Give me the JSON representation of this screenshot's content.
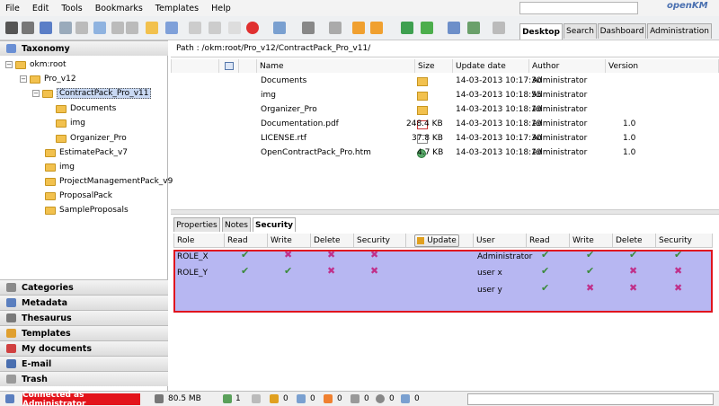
{
  "menu": [
    "File",
    "Edit",
    "Tools",
    "Bookmarks",
    "Templates",
    "Help"
  ],
  "logo": "openKM",
  "top_tabs": [
    "Desktop",
    "Search",
    "Dashboard",
    "Administration"
  ],
  "stack": {
    "taxonomy": "Taxonomy",
    "categories": "Categories",
    "metadata": "Metadata",
    "thesaurus": "Thesaurus",
    "templates": "Templates",
    "my_documents": "My documents",
    "email": "E-mail",
    "trash": "Trash"
  },
  "tree": [
    "okm:root",
    "Pro_v12",
    "ContractPack_Pro_v11",
    "Documents",
    "img",
    "Organizer_Pro",
    "EstimatePack_v7",
    "img",
    "ProjectManagementPack_v9",
    "ProposalPack",
    "SampleProposals"
  ],
  "path": "Path : /okm:root/Pro_v12/ContractPack_Pro_v11/",
  "file_columns": [
    "Name",
    "Size",
    "Update date",
    "Author",
    "Version"
  ],
  "files": [
    {
      "name": "Documents",
      "size": "",
      "date": "14-03-2013 10:17:30",
      "author": "Administrator",
      "version": ""
    },
    {
      "name": "img",
      "size": "",
      "date": "14-03-2013 10:18:55",
      "author": "Administrator",
      "version": ""
    },
    {
      "name": "Organizer_Pro",
      "size": "",
      "date": "14-03-2013 10:18:19",
      "author": "Administrator",
      "version": ""
    },
    {
      "name": "Documentation.pdf",
      "size": "248.4 KB",
      "date": "14-03-2013 10:18:19",
      "author": "Administrator",
      "version": "1.0"
    },
    {
      "name": "LICENSE.rtf",
      "size": "37.8 KB",
      "date": "14-03-2013 10:17:30",
      "author": "Administrator",
      "version": "1.0"
    },
    {
      "name": "OpenContractPack_Pro.htm",
      "size": "4.7 KB",
      "date": "14-03-2013 10:18:19",
      "author": "Administrator",
      "version": "1.0"
    }
  ],
  "bottom_tabs": [
    "Properties",
    "Notes",
    "Security"
  ],
  "security": {
    "role_cols": [
      "Role",
      "Read",
      "Write",
      "Delete",
      "Security"
    ],
    "update_label": "Update",
    "user_cols": [
      "User",
      "Read",
      "Write",
      "Delete",
      "Security"
    ],
    "roles": [
      {
        "name": "ROLE_X",
        "perms": [
          true,
          false,
          false,
          false
        ]
      },
      {
        "name": "ROLE_Y",
        "perms": [
          true,
          true,
          false,
          false
        ]
      }
    ],
    "users": [
      {
        "name": "Administrator",
        "perms": [
          true,
          true,
          true,
          true
        ]
      },
      {
        "name": "user x",
        "perms": [
          true,
          true,
          false,
          false
        ]
      },
      {
        "name": "user y",
        "perms": [
          true,
          false,
          false,
          false
        ]
      }
    ]
  },
  "status": {
    "connected": "Connected as Administrator",
    "memory": "80.5 MB",
    "counts": [
      "1",
      "0",
      "0",
      "0",
      "0",
      "0",
      "0"
    ]
  },
  "colors": {
    "selection": "#b7b7f2",
    "highlight_border": "#e0141e",
    "connected_bg": "#e3141b"
  }
}
